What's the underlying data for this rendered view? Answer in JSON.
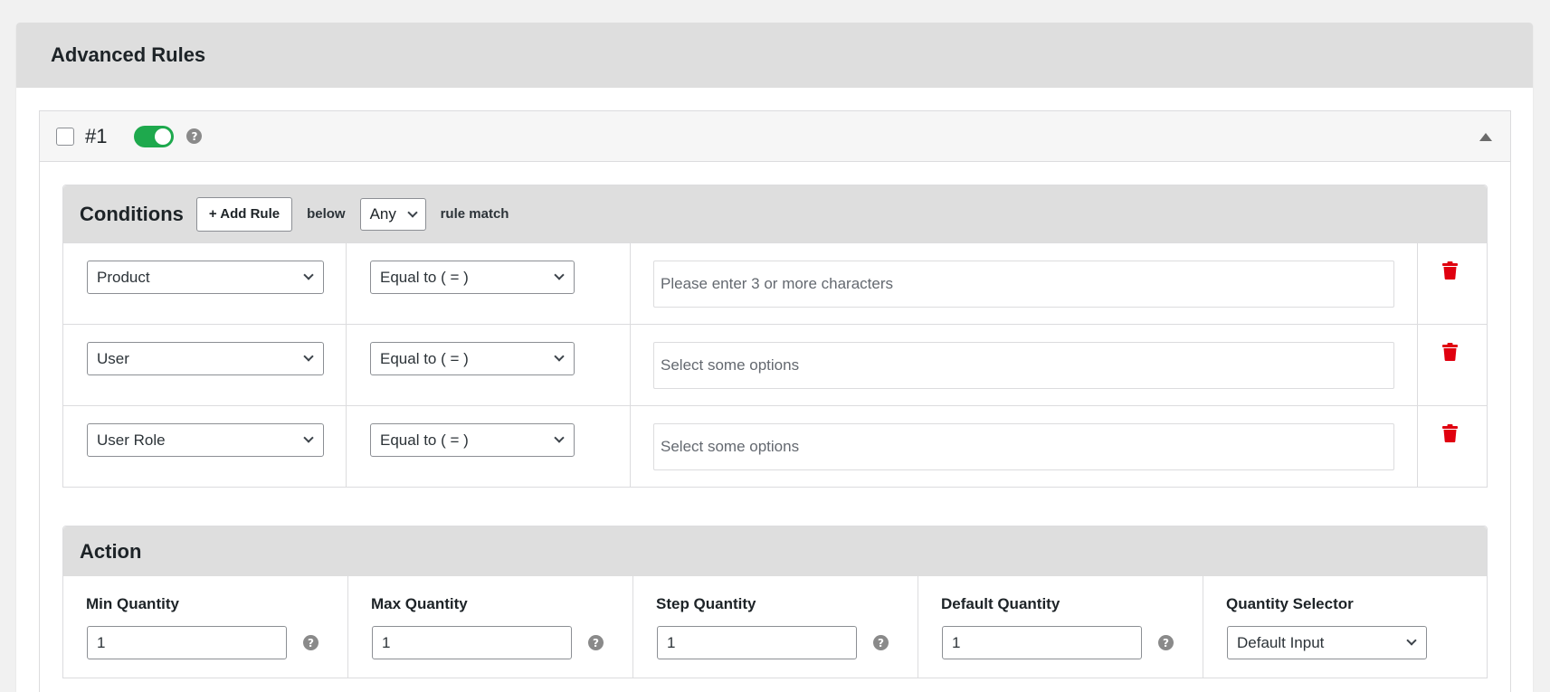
{
  "panel": {
    "title": "Advanced Rules"
  },
  "rule": {
    "number": "#1",
    "enabled": true,
    "conditions": {
      "title": "Conditions",
      "add_rule_label": "+ Add Rule",
      "below_label": "below",
      "match_value": "Any",
      "rule_match_label": "rule match",
      "rows": [
        {
          "field": "Product",
          "operator": "Equal to ( = )",
          "value_placeholder": "Please enter 3 or more characters"
        },
        {
          "field": "User",
          "operator": "Equal to ( = )",
          "value_placeholder": "Select some options"
        },
        {
          "field": "User Role",
          "operator": "Equal to ( = )",
          "value_placeholder": "Select some options"
        }
      ]
    },
    "action": {
      "title": "Action",
      "fields": [
        {
          "label": "Min Quantity",
          "value": "1"
        },
        {
          "label": "Max Quantity",
          "value": "1"
        },
        {
          "label": "Step Quantity",
          "value": "1"
        },
        {
          "label": "Default Quantity",
          "value": "1"
        },
        {
          "label": "Quantity Selector",
          "value": "Default Input"
        }
      ]
    }
  },
  "colors": {
    "toggle_on": "#1ea94d",
    "delete_icon": "#e0000f",
    "header_bg": "#dedede"
  },
  "icons": {
    "help": "question-circle-icon",
    "delete": "trash-icon",
    "collapse": "caret-up-icon"
  }
}
